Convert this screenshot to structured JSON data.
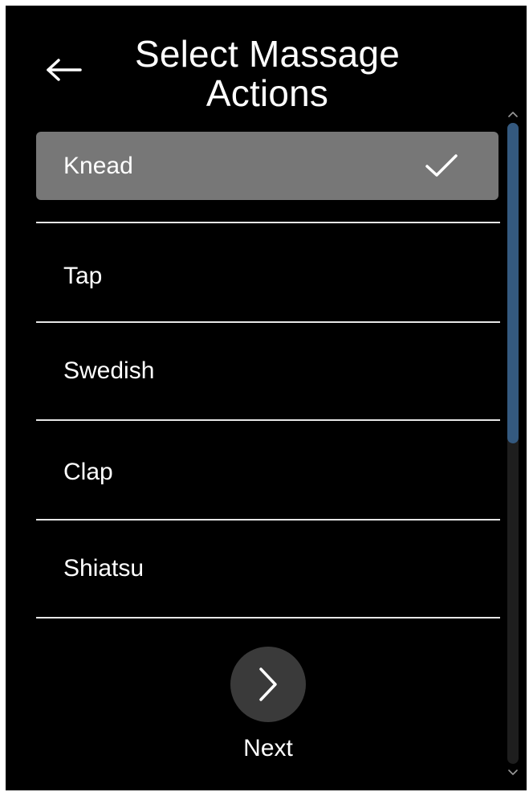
{
  "header": {
    "title": "Select Massage Actions",
    "back_icon": "left-arrow-icon"
  },
  "actions": [
    {
      "label": "Knead",
      "selected": true
    },
    {
      "label": "Tap",
      "selected": false
    },
    {
      "label": "Swedish",
      "selected": false
    },
    {
      "label": "Clap",
      "selected": false
    },
    {
      "label": "Shiatsu",
      "selected": false
    }
  ],
  "next": {
    "label": "Next",
    "icon": "chevron-right-icon"
  },
  "scrollbar": {
    "thumb_fraction": 0.5,
    "position_fraction": 0.0
  },
  "colors": {
    "background": "#000000",
    "selected_row": "#777777",
    "next_button": "#3a3a3a",
    "scroll_thumb": "#34597f",
    "text": "#ffffff"
  }
}
